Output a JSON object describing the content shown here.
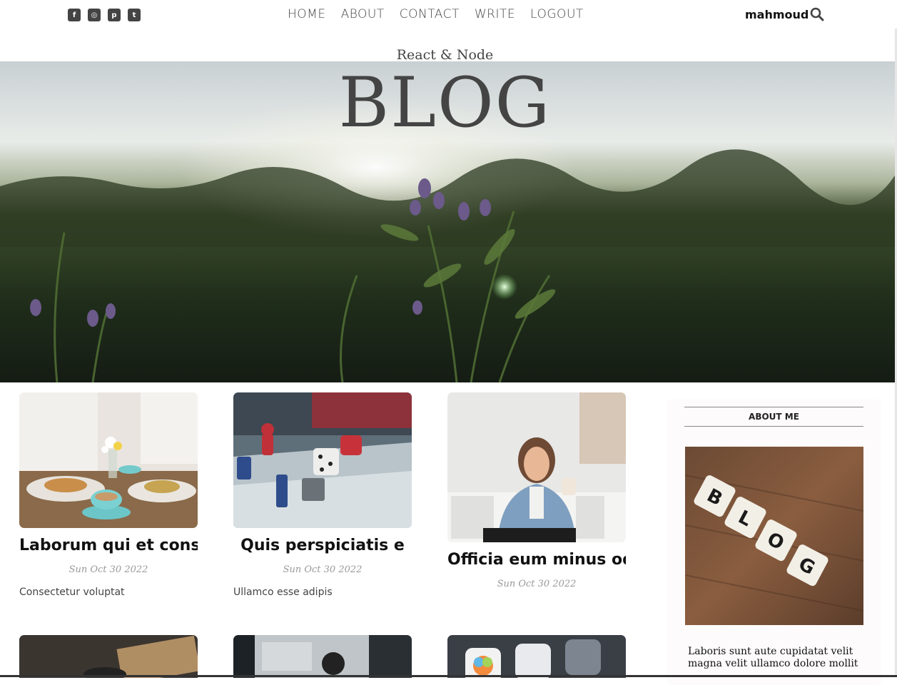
{
  "topbar": {
    "social_icons": [
      {
        "name": "facebook-square-icon",
        "glyph": "f"
      },
      {
        "name": "instagram-square-icon",
        "glyph": "◎"
      },
      {
        "name": "pinterest-square-icon",
        "glyph": "p"
      },
      {
        "name": "twitter-square-icon",
        "glyph": "t"
      }
    ],
    "nav": [
      "HOME",
      "ABOUT",
      "CONTACT",
      "WRITE",
      "LOGOUT"
    ],
    "username": "mahmoud"
  },
  "header": {
    "subtitle": "React & Node",
    "title": "BLOG"
  },
  "posts": [
    {
      "title": "Laborum qui et conse",
      "date": "Sun Oct 30 2022",
      "desc": "Consectetur voluptat"
    },
    {
      "title": "Quis perspiciatis e",
      "date": "Sun Oct 30 2022",
      "desc": "Ullamco esse adipis"
    },
    {
      "title": "Officia eum minus od",
      "date": "Sun Oct 30 2022",
      "desc": ""
    }
  ],
  "sidebar": {
    "title": "ABOUT ME",
    "text": "Laboris sunt aute cupidatat velit magna velit ullamco dolore mollit"
  },
  "colors": {
    "text_dark": "#444444",
    "date_gray": "#999999"
  }
}
